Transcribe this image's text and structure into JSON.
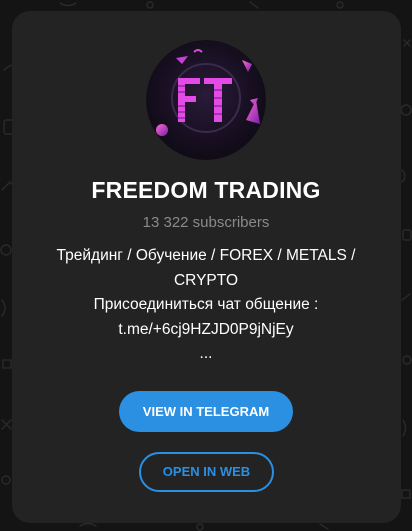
{
  "channel": {
    "title": "FREEDOM TRADING",
    "subscribers": "13 322 subscribers",
    "avatar_text": "FT",
    "description_lines": [
      "Трейдинг / Обучение / FOREX / METALS /",
      "CRYPTO",
      "Присоединиться чат общение :",
      "t.me/+6cj9HZJD0P9jNjEy",
      "..."
    ]
  },
  "actions": {
    "view_label": "VIEW IN TELEGRAM",
    "open_web_label": "OPEN IN WEB"
  },
  "colors": {
    "page_background": "#141414",
    "card_background": "#232323",
    "accent": "#2b8fe2",
    "avatar_letters": "#e44be6",
    "subtle_text": "#8a8a8a"
  },
  "icons": [
    "doodle-pattern-icon"
  ]
}
